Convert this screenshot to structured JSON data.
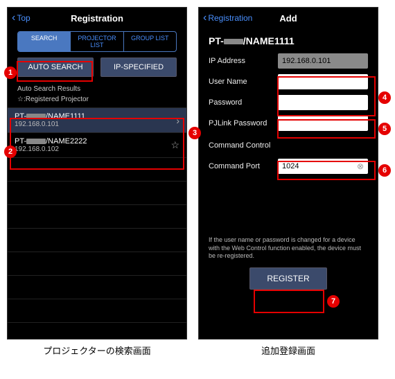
{
  "left": {
    "back": "Top",
    "title": "Registration",
    "seg": {
      "search": "SEARCH",
      "plist": "PROJECTOR LIST",
      "glist": "GROUP LIST"
    },
    "btn_auto": "AUTO SEARCH",
    "btn_ip": "IP-SPECIFIED",
    "results_label": "Auto Search Results",
    "registered_label": "☆:Registered Projector",
    "rows": [
      {
        "name_prefix": "PT-",
        "name_suffix": "/NAME1111",
        "ip": "192.168.0.101",
        "selected": true,
        "icon": "chevron"
      },
      {
        "name_prefix": "PT-",
        "name_suffix": "/NAME2222",
        "ip": "192.168.0.102",
        "selected": false,
        "icon": "star"
      }
    ],
    "caption": "プロジェクターの検索画面"
  },
  "right": {
    "back": "Registration",
    "title": "Add",
    "heading_prefix": "PT-",
    "heading_suffix": "/NAME1111",
    "ip_label": "IP Address",
    "ip_value": "192.168.0.101",
    "user_label": "User Name",
    "pass_label": "Password",
    "pj_label": "PJLink Password",
    "cc_label": "Command Control",
    "cp_label": "Command Port",
    "cp_value": "1024",
    "note": "If the user name or password is changed for a device with the Web Control function enabled, the device must be re-registered.",
    "register": "REGISTER",
    "caption": "追加登録画面"
  },
  "callouts": {
    "c1": "1",
    "c2": "2",
    "c3": "3",
    "c4": "4",
    "c5": "5",
    "c6": "6",
    "c7": "7"
  }
}
